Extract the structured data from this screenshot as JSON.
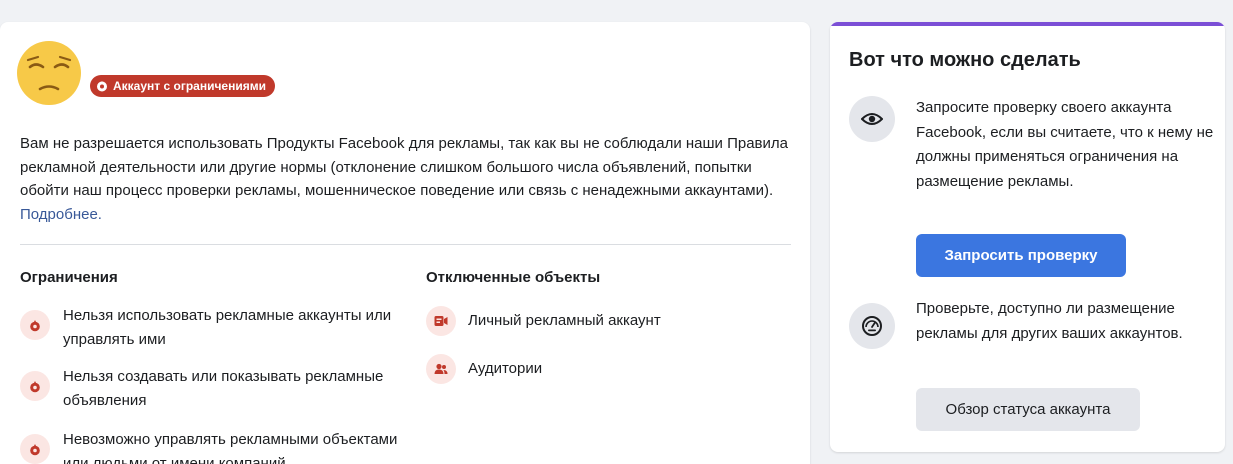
{
  "account": {
    "emoji_icon": "pensive-face-emoji",
    "status_badge": "Аккаунт с ограничениями",
    "status_color": "#c0392b",
    "description": "Вам не разрешается использовать Продукты Facebook для рекламы, так как вы не соблюдали наши Правила рекламной деятельности или другие нормы (отклонение слишком большого числа объявлений, попытки обойти наш процесс проверки рекламы, мошенническое поведение или связь с ненадежными аккаунтами).",
    "learn_more": "Подробнее."
  },
  "restrictions": {
    "title": "Ограничения",
    "icon": "restriction-icon",
    "items": [
      {
        "label": "Нельзя использовать рекламные аккаунты или управлять ими"
      },
      {
        "label": "Нельзя создавать или показывать рекламные объявления"
      },
      {
        "label": "Невозможно управлять рекламными объектами или людьми от имени компаний"
      }
    ]
  },
  "disabled_objects": {
    "title": "Отключенные объекты",
    "items": [
      {
        "label": "Личный рекламный аккаунт",
        "icon": "ad-account-icon"
      },
      {
        "label": "Аудитории",
        "icon": "audience-icon"
      }
    ]
  },
  "actions_panel": {
    "title": "Вот что можно сделать",
    "accent_color": "#7b4fd6",
    "review": {
      "icon": "eye-icon",
      "text": "Запросите проверку своего аккаунта Facebook, если вы считаете, что к нему не должны применяться ограничения на размещение рекламы.",
      "button_label": "Запросить проверку",
      "button_color": "#3b76e0"
    },
    "status": {
      "icon": "gauge-icon",
      "text": "Проверьте, доступно ли размещение рекламы для других ваших аккаунтов.",
      "button_label": "Обзор статуса аккаунта"
    }
  }
}
